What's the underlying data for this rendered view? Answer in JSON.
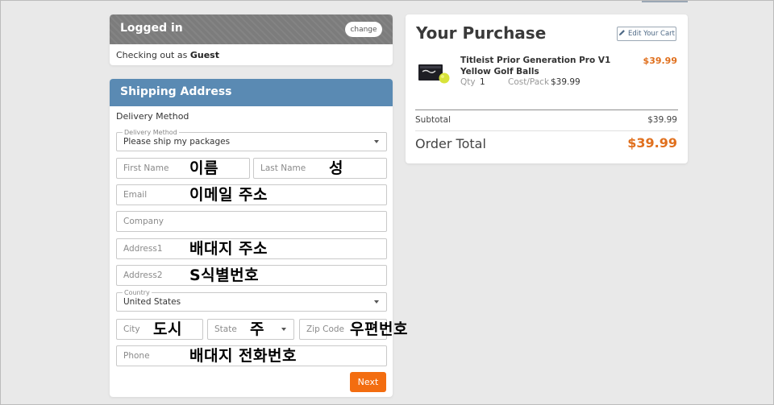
{
  "account": {
    "header": "Logged in",
    "change_label": "change",
    "checkout_prefix": "Checking out as",
    "checkout_user": "Guest"
  },
  "shipping": {
    "header": "Shipping Address",
    "delivery_label": "Delivery Method",
    "delivery": {
      "label": "Delivery Method",
      "value": "Please ship my packages"
    },
    "first_name": {
      "placeholder": "First Name",
      "annotation": "이름"
    },
    "last_name": {
      "placeholder": "Last Name",
      "annotation": "성"
    },
    "email": {
      "placeholder": "Email",
      "annotation": "이메일 주소"
    },
    "company": {
      "placeholder": "Company"
    },
    "address1": {
      "placeholder": "Address1",
      "annotation": "배대지 주소"
    },
    "address2": {
      "placeholder": "Address2",
      "annotation": "S식별번호"
    },
    "country": {
      "label": "Country",
      "value": "United States"
    },
    "city": {
      "placeholder": "City",
      "annotation": "도시"
    },
    "state": {
      "placeholder": "State",
      "annotation": "주"
    },
    "zip": {
      "placeholder": "Zip Code",
      "annotation": "우편번호"
    },
    "phone": {
      "placeholder": "Phone",
      "annotation": "배대지 전화번호"
    },
    "next_label": "Next"
  },
  "purchase": {
    "title": "Your Purchase",
    "edit_cart_label": "Edit Your Cart",
    "item": {
      "name": "Titleist Prior Generation Pro V1 Yellow Golf Balls",
      "price": "$39.99",
      "qty_label": "Qty",
      "qty": "1",
      "cost_label": "Cost/Pack",
      "cost": "$39.99"
    },
    "subtotal_label": "Subtotal",
    "subtotal": "$39.99",
    "total_label": "Order Total",
    "total": "$39.99"
  },
  "colors": {
    "accent_orange": "#f36d10",
    "price_orange": "#e0701e",
    "shipping_header": "#5a8ab3",
    "logged_header": "#7c7c7c"
  }
}
